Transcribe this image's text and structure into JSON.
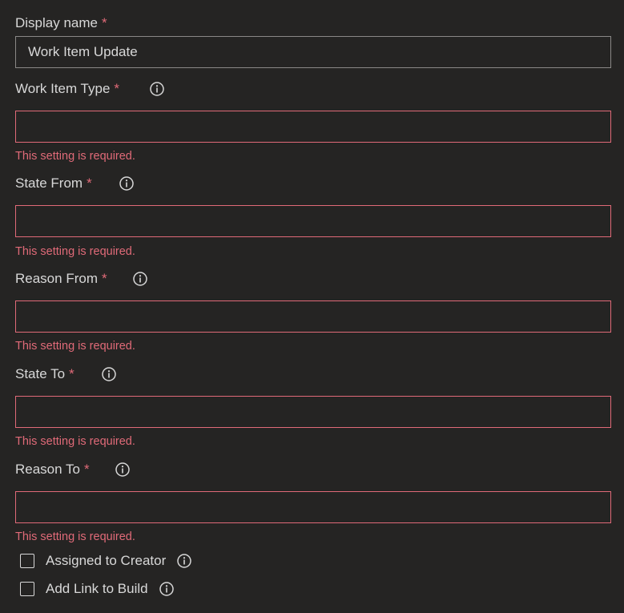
{
  "display_name": {
    "label": "Display name",
    "required_mark": "*",
    "value": "Work Item Update"
  },
  "fields": [
    {
      "id": "work-item-type",
      "label": "Work Item Type",
      "required_mark": "*",
      "value": "",
      "error": "This setting is required.",
      "icon": "info-icon"
    },
    {
      "id": "state-from",
      "label": "State From",
      "required_mark": "*",
      "value": "",
      "error": "This setting is required.",
      "icon": "info-icon"
    },
    {
      "id": "reason-from",
      "label": "Reason From",
      "required_mark": "*",
      "value": "",
      "error": "This setting is required.",
      "icon": "info-icon"
    },
    {
      "id": "state-to",
      "label": "State To",
      "required_mark": "*",
      "value": "",
      "error": "This setting is required.",
      "icon": "info-icon"
    },
    {
      "id": "reason-to",
      "label": "Reason To",
      "required_mark": "*",
      "value": "",
      "error": "This setting is required.",
      "icon": "info-icon"
    }
  ],
  "checkboxes": [
    {
      "id": "assigned-to-creator",
      "label": "Assigned to Creator",
      "checked": false,
      "icon": "info-icon"
    },
    {
      "id": "add-link-to-build",
      "label": "Add Link to Build",
      "checked": false,
      "icon": "info-icon"
    }
  ],
  "colors": {
    "background": "#252423",
    "text": "#d8d8d8",
    "error": "#e06a78",
    "border": "#8a8886"
  }
}
